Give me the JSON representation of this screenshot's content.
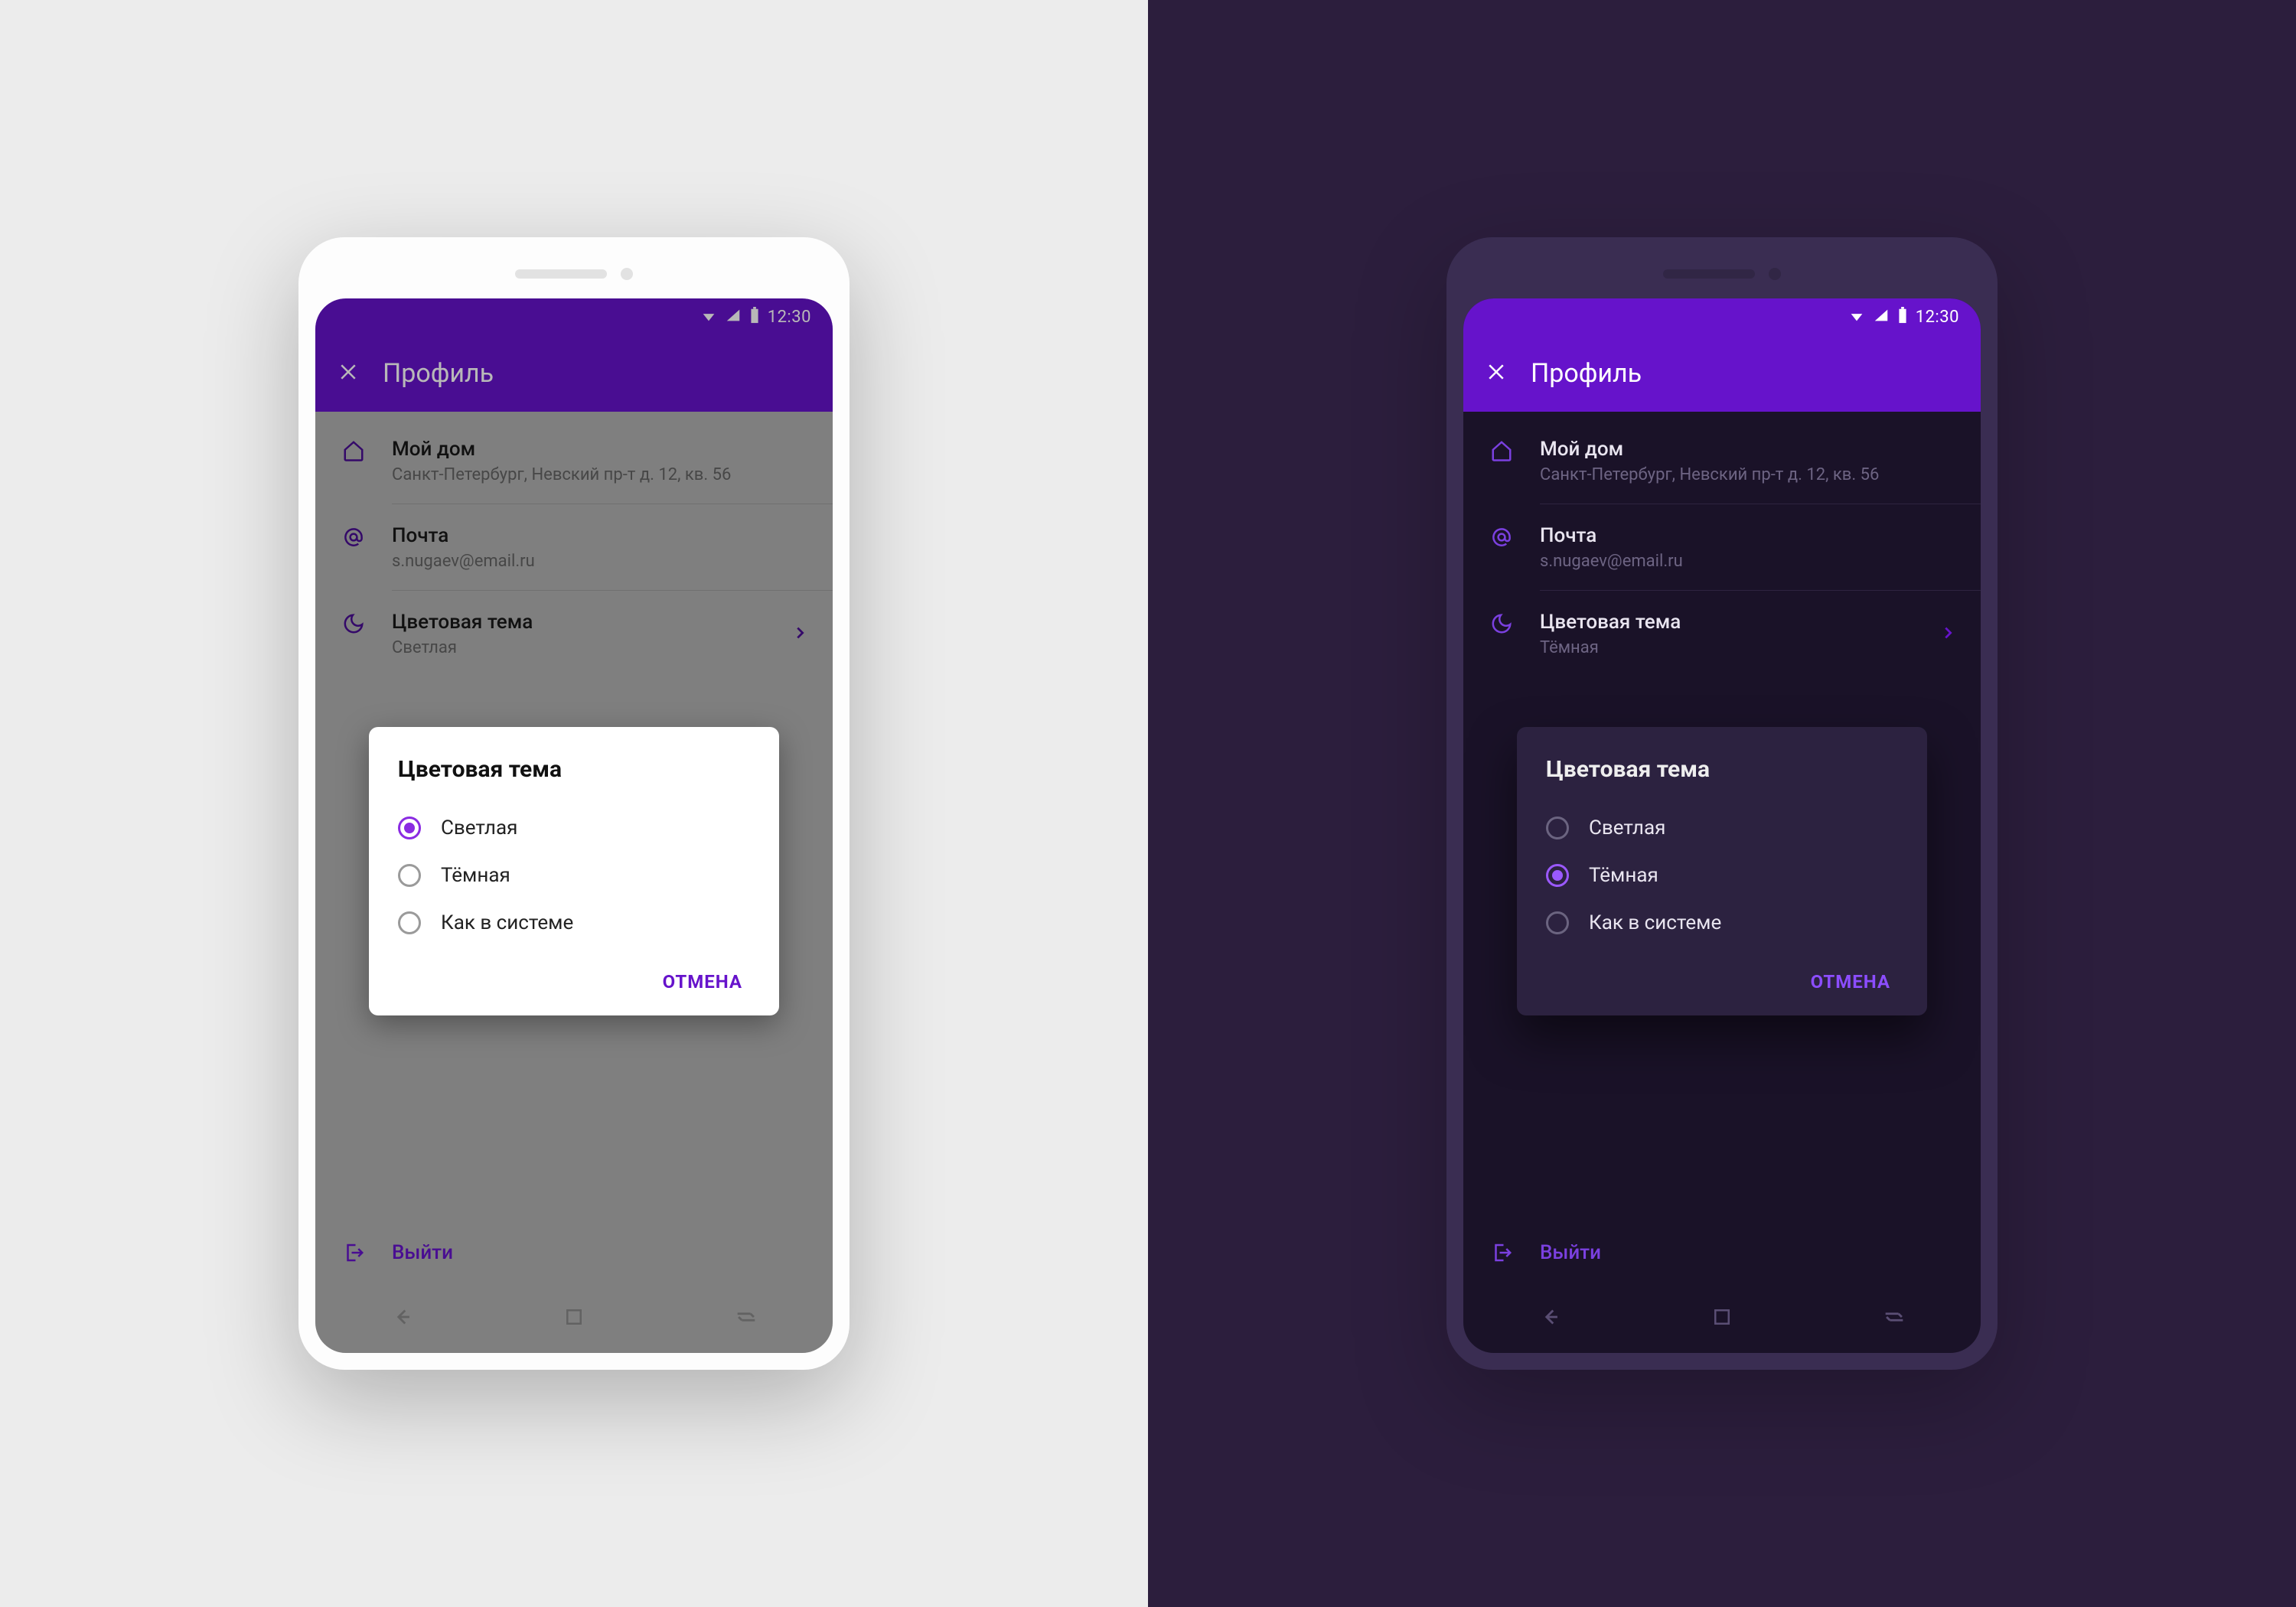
{
  "status": {
    "time": "12:30"
  },
  "appbar": {
    "title": "Профиль"
  },
  "rows": {
    "home": {
      "label": "Мой дом",
      "sub": "Санкт-Петербург, Невский пр-т д. 12, кв. 56"
    },
    "email": {
      "label": "Почта",
      "sub": "s.nugaev@email.ru"
    },
    "theme_light": {
      "label": "Цветовая тема",
      "sub": "Светлая"
    },
    "theme_dark": {
      "label": "Цветовая тема",
      "sub": "Тёмная"
    }
  },
  "dialog": {
    "title": "Цветовая тема",
    "options": {
      "light": "Светлая",
      "dark": "Тёмная",
      "system": "Как в системе"
    },
    "cancel": "ОТМЕНА"
  },
  "logout": {
    "label": "Выйти"
  },
  "colors": {
    "accent": "#6613cb"
  }
}
